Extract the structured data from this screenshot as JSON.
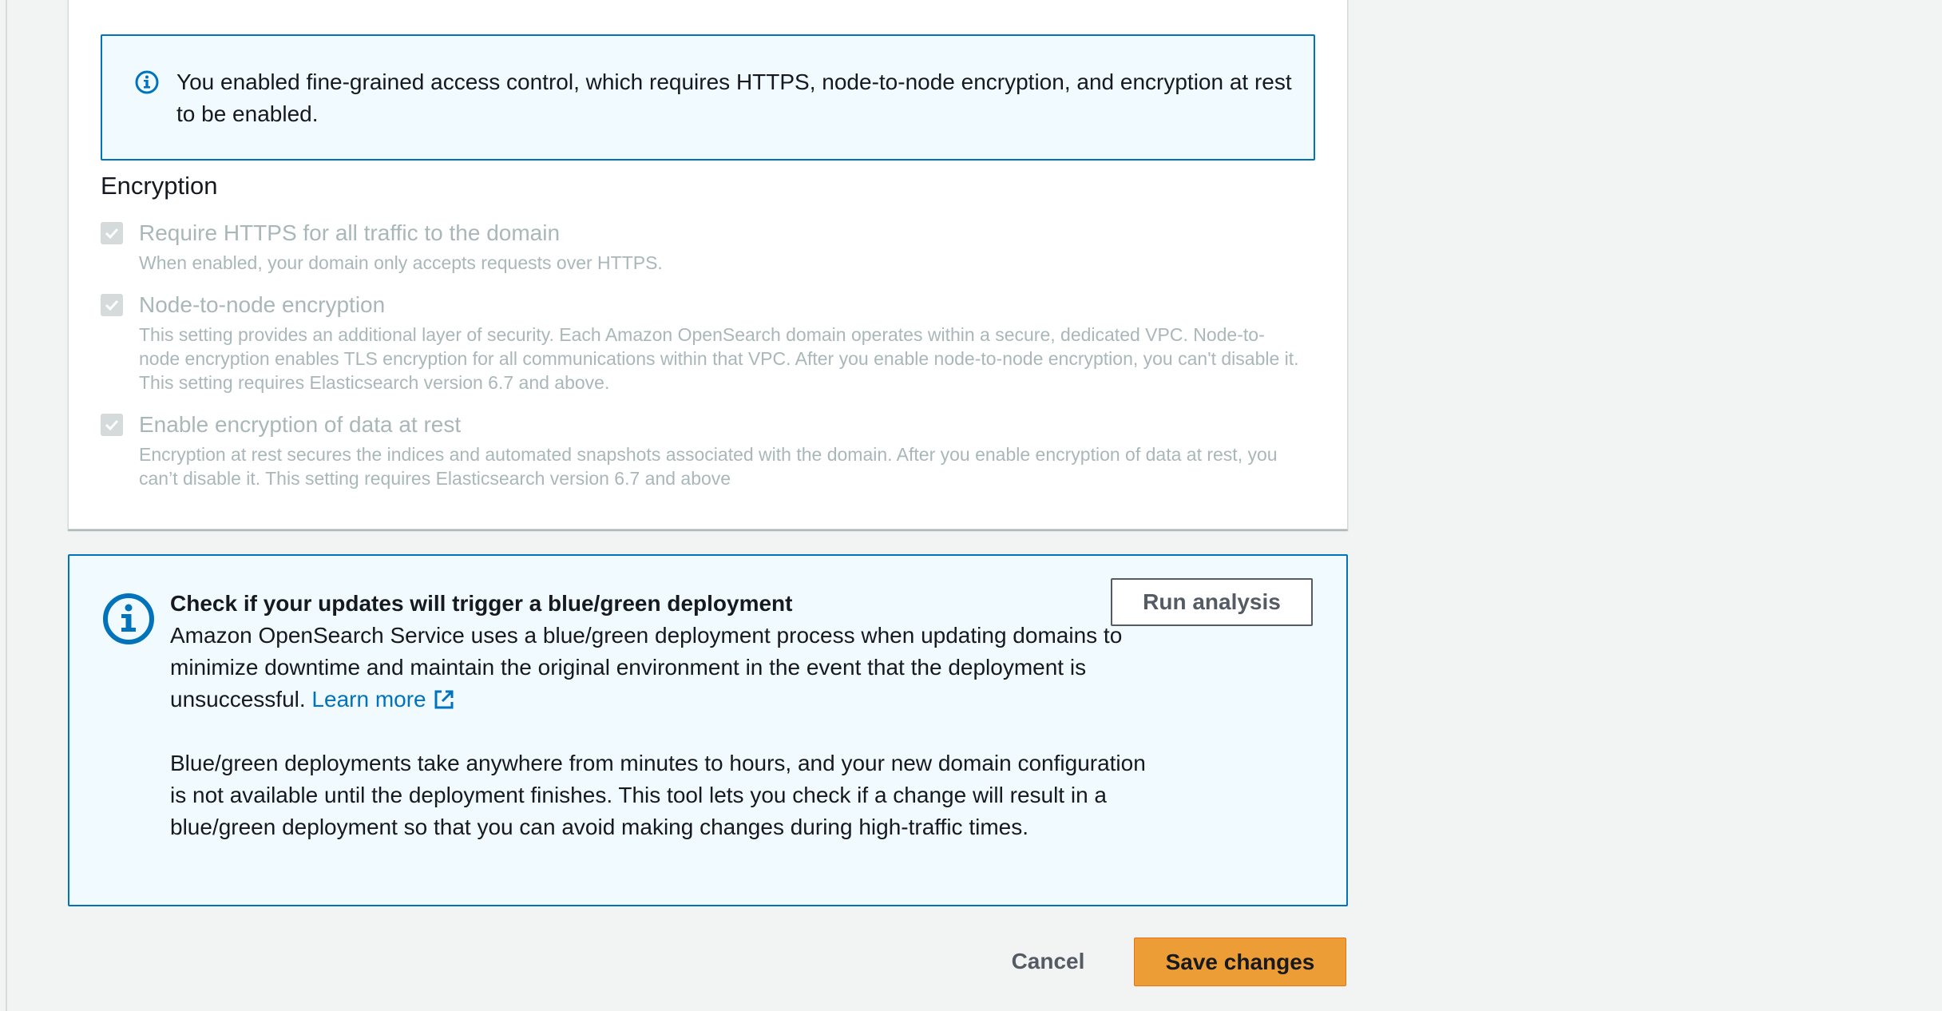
{
  "fgac_alert": {
    "icon": "info-icon",
    "text": "You enabled fine-grained access control, which requires HTTPS, node-to-node encryption, and encryption at rest to be enabled."
  },
  "encryption": {
    "title": "Encryption",
    "options": [
      {
        "label": "Require HTTPS for all traffic to the domain",
        "description": "When enabled, your domain only accepts requests over HTTPS.",
        "checked": true,
        "disabled": true
      },
      {
        "label": "Node-to-node encryption",
        "description": "This setting provides an additional layer of security. Each Amazon OpenSearch domain operates within a secure, dedicated VPC. Node-to-node encryption enables TLS encryption for all communications within that VPC. After you enable node-to-node encryption, you can't disable it. This setting requires Elasticsearch version 6.7 and above.",
        "checked": true,
        "disabled": true
      },
      {
        "label": "Enable encryption of data at rest",
        "description": "Encryption at rest secures the indices and automated snapshots associated with the domain. After you enable encryption of data at rest, you can’t disable it. This setting requires Elasticsearch version 6.7 and above",
        "checked": true,
        "disabled": true
      }
    ]
  },
  "bluegreen": {
    "icon": "info-icon",
    "heading": "Check if your updates will trigger a blue/green deployment",
    "paragraph1": "Amazon OpenSearch Service uses a blue/green deployment process when updating domains to minimize downtime and maintain the original environment in the event that the deployment is unsuccessful.",
    "learn_more": "Learn more",
    "learn_more_icon": "external-link-icon",
    "paragraph2": "Blue/green deployments take anywhere from minutes to hours, and your new domain configuration is not available until the deployment finishes. This tool lets you check if a change will result in a blue/green deployment so that you can avoid making changes during high-traffic times.",
    "run_analysis_label": "Run analysis"
  },
  "footer": {
    "cancel_label": "Cancel",
    "save_label": "Save changes"
  },
  "colors": {
    "accent_blue": "#0073bb",
    "primary_orange": "#ec9d35",
    "disabled_text": "#aab7b8"
  }
}
